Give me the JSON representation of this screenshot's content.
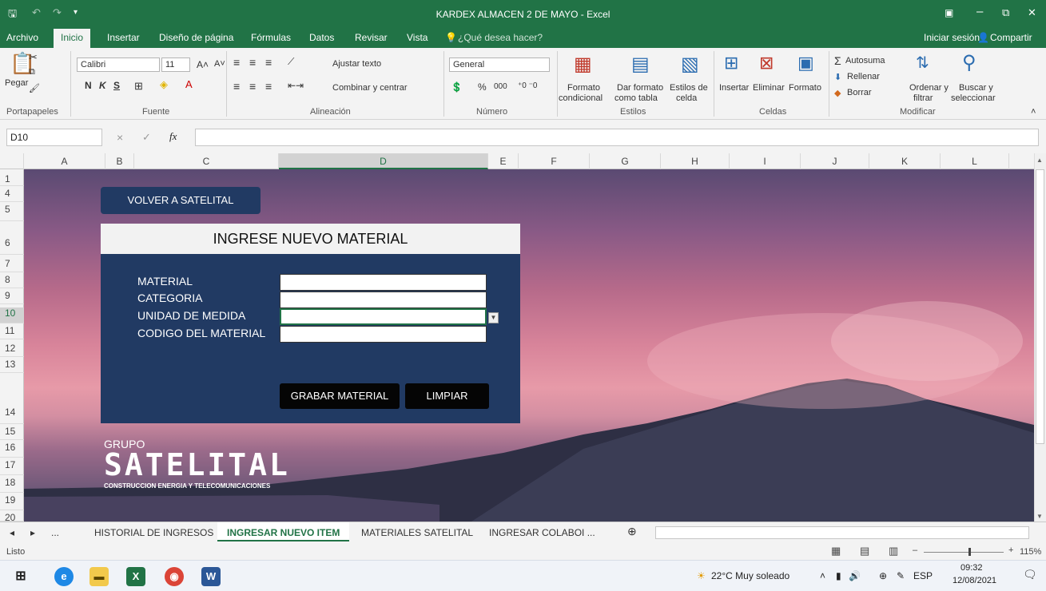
{
  "window": {
    "title": "KARDEX ALMACEN 2 DE MAYO - Excel",
    "minimize": "–",
    "restore": "⧉",
    "close": "✕"
  },
  "menu": {
    "items": [
      "Archivo",
      "Inicio",
      "Insertar",
      "Diseño de página",
      "Fórmulas",
      "Datos",
      "Revisar",
      "Vista"
    ],
    "tell_me": "¿Qué desea hacer?",
    "signin": "Iniciar sesión",
    "share": "Compartir"
  },
  "ribbon": {
    "clipboard": {
      "paste": "Pegar",
      "group": "Portapapeles"
    },
    "font": {
      "name": "Calibri",
      "size": "11",
      "bold": "N",
      "italic": "K",
      "underline": "S",
      "group": "Fuente"
    },
    "alignment": {
      "wrap": "Ajustar texto",
      "merge": "Combinar y centrar",
      "group": "Alineación"
    },
    "number": {
      "format": "General",
      "percent": "%",
      "thousands": "000",
      "group": "Número"
    },
    "styles": {
      "cond1": "Formato",
      "cond2": "condicional",
      "table1": "Dar formato",
      "table2": "como tabla",
      "cell1": "Estilos de",
      "cell2": "celda",
      "group": "Estilos"
    },
    "cells": {
      "insert": "Insertar",
      "delete": "Eliminar",
      "format": "Formato",
      "group": "Celdas"
    },
    "editing": {
      "autosum": "Autosuma",
      "fill": "Rellenar",
      "clear": "Borrar",
      "sort1": "Ordenar y",
      "sort2": "filtrar",
      "find1": "Buscar y",
      "find2": "seleccionar",
      "group": "Modificar"
    }
  },
  "formula_bar": {
    "name_box": "D10",
    "fx": "fx",
    "cancel": "×",
    "enter": "✓",
    "content": ""
  },
  "columns": [
    "A",
    "B",
    "C",
    "D",
    "E",
    "F",
    "G",
    "H",
    "I",
    "J",
    "K",
    "L"
  ],
  "rows": [
    "1",
    "4",
    "5",
    "6",
    "7",
    "8",
    "9",
    "10",
    "11",
    "12",
    "13",
    "14",
    "15",
    "16",
    "17",
    "18",
    "19",
    "20"
  ],
  "sheet": {
    "back_button": "VOLVER A SATELITAL",
    "panel_title": "INGRESE NUEVO MATERIAL",
    "fields": [
      {
        "label": "MATERIAL",
        "value": ""
      },
      {
        "label": "CATEGORIA",
        "value": ""
      },
      {
        "label": "UNIDAD DE MEDIDA",
        "value": ""
      },
      {
        "label": "CODIGO DEL MATERIAL",
        "value": ""
      }
    ],
    "save_button": "GRABAR MATERIAL",
    "clear_button": "LIMPIAR",
    "logo": {
      "group": "GRUPO",
      "name": "SATELITAL",
      "tagline": "CONSTRUCCION ENERGIA Y TELECOMUNICACIONES"
    }
  },
  "tabs": {
    "nav_prev": "◂",
    "nav_next": "▸",
    "more": "...",
    "items": [
      "HISTORIAL DE INGRESOS",
      "INGRESAR NUEVO ITEM",
      "MATERIALES SATELITAL",
      "INGRESAR COLABOI ..."
    ],
    "active": "INGRESAR NUEVO ITEM",
    "add": "⊕"
  },
  "status": {
    "ready": "Listo",
    "zoom": "115%",
    "minus": "–",
    "plus": "+"
  },
  "taskbar": {
    "weather": "22°C  Muy soleado",
    "lang": "ESP",
    "time": "09:32",
    "date": "12/08/2021"
  }
}
